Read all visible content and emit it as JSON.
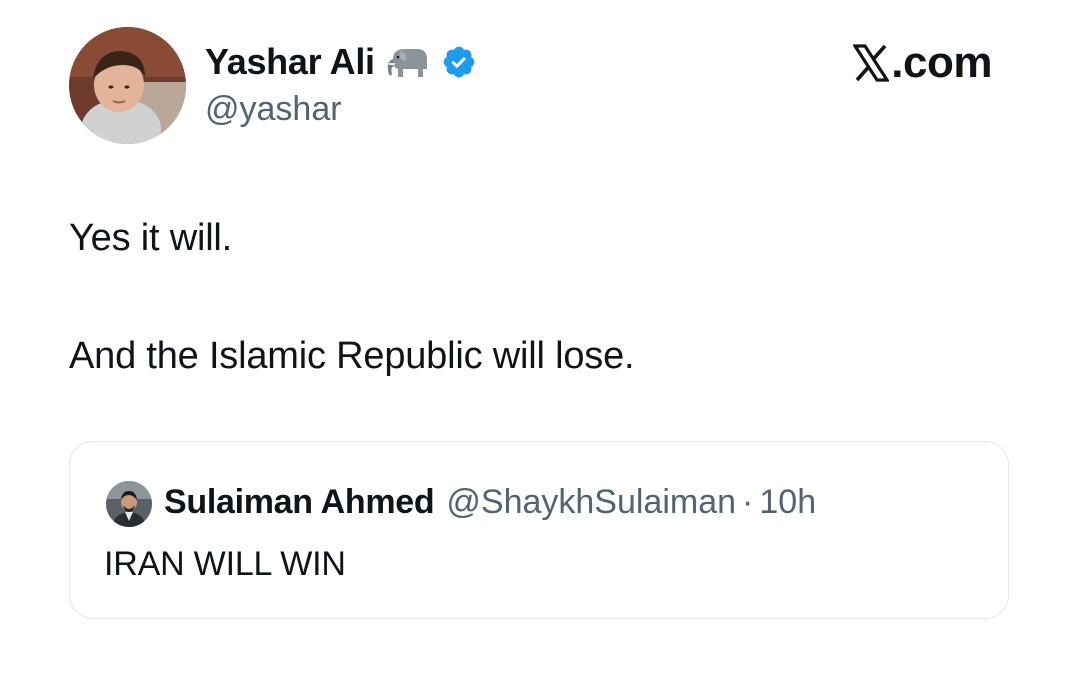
{
  "author": {
    "name": "Yashar Ali",
    "handle": "@yashar",
    "avatar_icon": "profile-photo",
    "emoji_icon": "elephant-icon",
    "verified_icon": "verified-badge-icon"
  },
  "brand": {
    "logo_icon": "x-logo-icon",
    "domain": ".com"
  },
  "tweet": {
    "lines": [
      "Yes it will.",
      "And the Islamic Republic will lose."
    ]
  },
  "quote": {
    "author_name": "Sulaiman Ahmed",
    "handle": "@ShaykhSulaiman",
    "separator": "·",
    "time": "10h",
    "text": "IRAN WILL WIN"
  },
  "colors": {
    "text_primary": "#0f1419",
    "text_secondary": "#536471",
    "verified_blue": "#1d9bf0",
    "card_border": "#e3e7ea",
    "background": "#ffffff"
  }
}
